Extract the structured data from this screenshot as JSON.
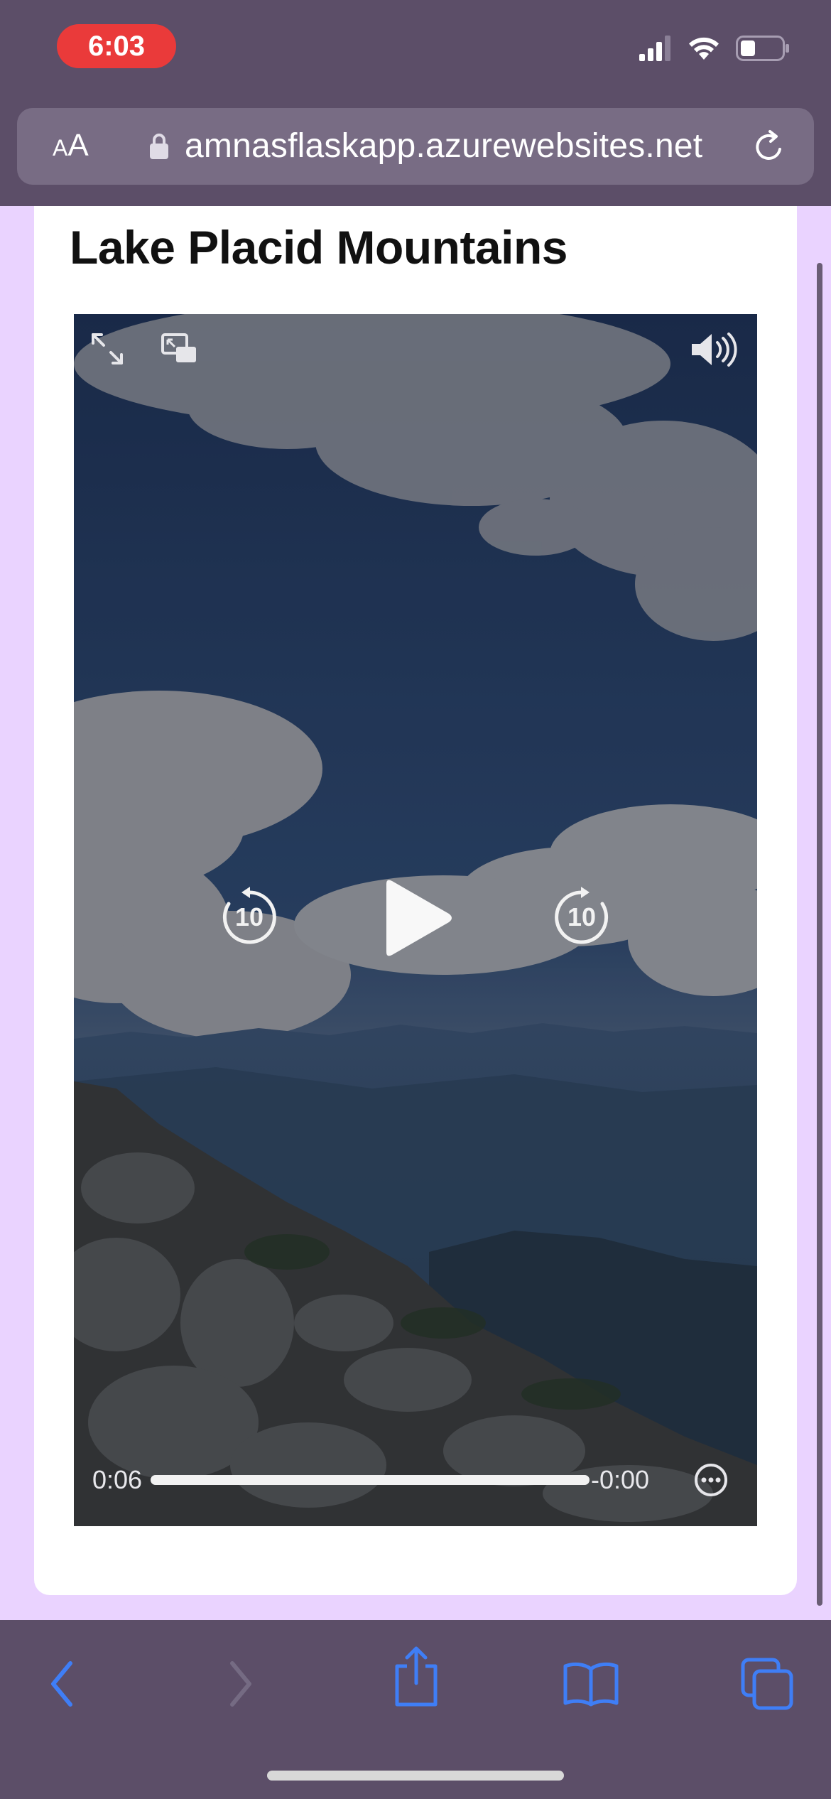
{
  "status_bar": {
    "time": "6:03",
    "icons": [
      "cellular-signal-icon",
      "wifi-icon",
      "battery-icon"
    ]
  },
  "address_bar": {
    "text_size_label": {
      "small": "A",
      "big": "A"
    },
    "url": "amnasflaskapp.azurewebsites.net",
    "icons": [
      "lock-icon",
      "reload-icon"
    ]
  },
  "page": {
    "title": "Lake Placid Mountains",
    "background_color": "#ead3ff",
    "card_color": "#ffffff"
  },
  "video": {
    "elapsed": "0:06",
    "remaining": "-0:00",
    "skip_back_seconds": "10",
    "skip_forward_seconds": "10",
    "progress_fraction": 1.0,
    "state": "paused"
  },
  "toolbar": {
    "accent_color": "#3f7ef6",
    "buttons": [
      "back",
      "forward",
      "share",
      "bookmarks",
      "tabs"
    ],
    "forward_enabled": false
  }
}
